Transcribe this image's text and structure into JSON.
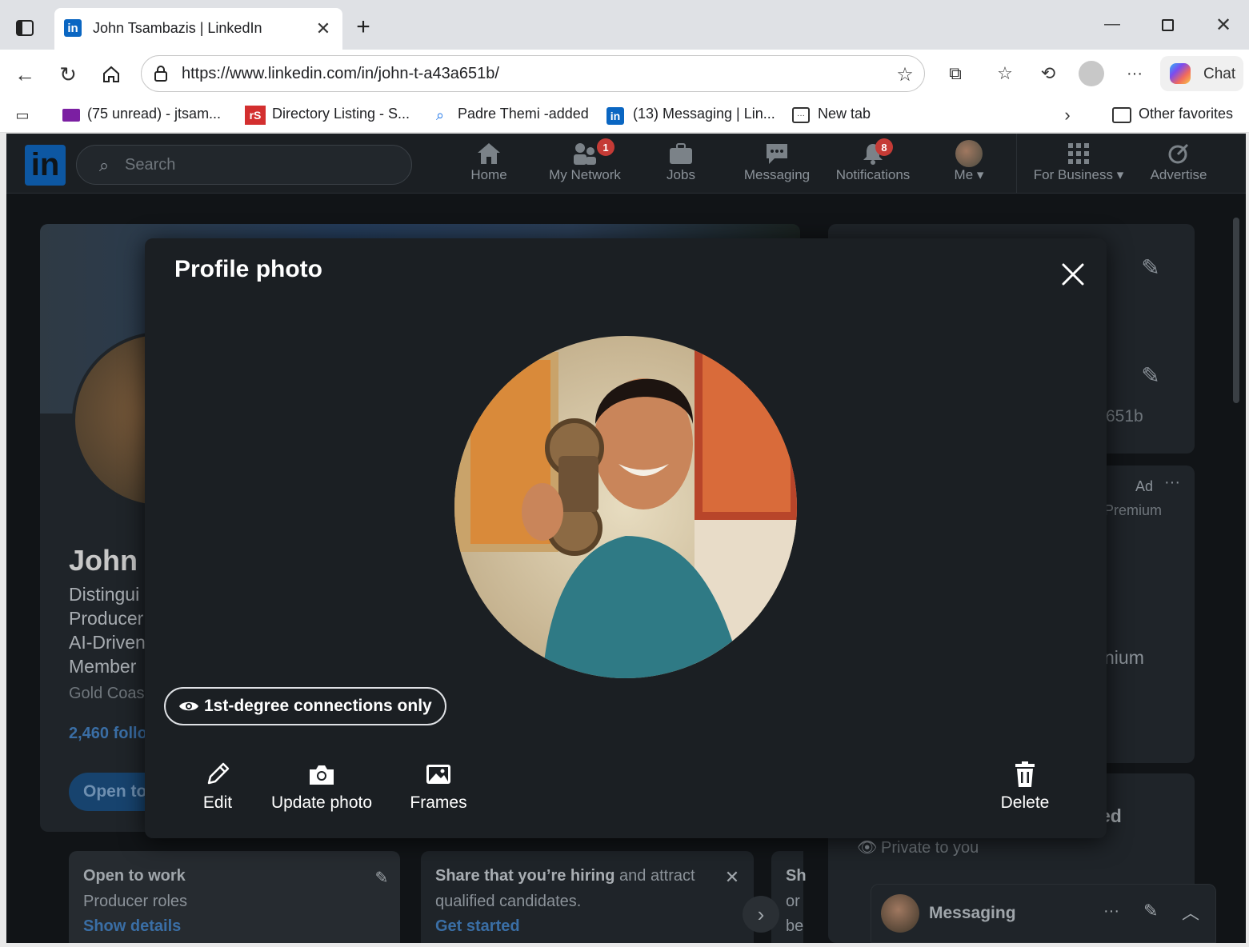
{
  "browser": {
    "tab_title": "John Tsambazis | LinkedIn",
    "url": "https://www.linkedin.com/in/john-t-a43a651b/",
    "copilot_label": "Chat",
    "bookmarks": [
      {
        "label": "(75 unread) - jtsam..."
      },
      {
        "label": "Directory Listing - S..."
      },
      {
        "label": "Padre Themi -added"
      },
      {
        "label": "(13) Messaging | Lin..."
      },
      {
        "label": "New tab"
      }
    ],
    "other_favorites": "Other favorites"
  },
  "nav": {
    "search_placeholder": "Search",
    "items": [
      {
        "label": "Home"
      },
      {
        "label": "My Network",
        "badge": "1"
      },
      {
        "label": "Jobs"
      },
      {
        "label": "Messaging"
      },
      {
        "label": "Notifications",
        "badge": "8"
      },
      {
        "label": "Me"
      },
      {
        "label": "For Business"
      },
      {
        "label": "Advertise"
      }
    ]
  },
  "background": {
    "name_partial": "John T",
    "headline_lines": [
      "Distingui",
      "Producer",
      "AI-Driven",
      "Member"
    ],
    "location_partial": "Gold Coas",
    "followers_partial": "2,460 follo",
    "open_to_btn_partial": "Open to",
    "right_url_partial": "651b",
    "ad_label": "Ad",
    "premium_partial": "Premium",
    "premium2_partial": "nium",
    "ed_partial": "ed",
    "private_label": "Private to you",
    "open_to_work": {
      "title": "Open to work",
      "subtitle": "Producer roles",
      "link": "Show details"
    },
    "hiring": {
      "bold": "Share that you’re hiring",
      "rest": "and attract",
      "line2": "qualified candidates.",
      "link": "Get started"
    },
    "third_partial": [
      "Sh",
      "or",
      "be"
    ],
    "messaging_label": "Messaging"
  },
  "modal": {
    "title": "Profile photo",
    "visibility": "1st-degree connections only",
    "actions": {
      "edit": "Edit",
      "update": "Update photo",
      "frames": "Frames",
      "delete": "Delete"
    }
  },
  "colors": {
    "linkedin_blue": "#0a66c2",
    "modal_bg": "#1b1f23",
    "badge_red": "#c53b36"
  }
}
